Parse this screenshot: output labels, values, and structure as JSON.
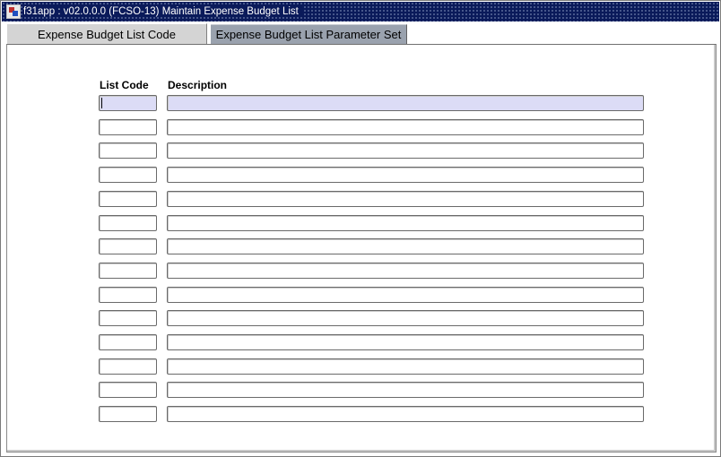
{
  "window": {
    "title": "f31app : v02.0.0.0 (FCSO-13) Maintain Expense Budget List"
  },
  "tabs": [
    {
      "label": "Expense Budget List Code",
      "active": true
    },
    {
      "label": "Expense Budget List Parameter Set",
      "active": false
    }
  ],
  "table": {
    "headers": {
      "code": "List Code",
      "description": "Description"
    },
    "rows": [
      {
        "code": "",
        "description": ""
      },
      {
        "code": "",
        "description": ""
      },
      {
        "code": "",
        "description": ""
      },
      {
        "code": "",
        "description": ""
      },
      {
        "code": "",
        "description": ""
      },
      {
        "code": "",
        "description": ""
      },
      {
        "code": "",
        "description": ""
      },
      {
        "code": "",
        "description": ""
      },
      {
        "code": "",
        "description": ""
      },
      {
        "code": "",
        "description": ""
      },
      {
        "code": "",
        "description": ""
      },
      {
        "code": "",
        "description": ""
      },
      {
        "code": "",
        "description": ""
      },
      {
        "code": "",
        "description": ""
      }
    ],
    "focused_row": 0
  },
  "colors": {
    "titlebar": "#0a1a5a",
    "active_tab": "#d4d4d4",
    "inactive_tab": "#9aa2ae",
    "focused_field": "#dcdcf6"
  },
  "icons": {
    "app": "app-window-icon"
  }
}
